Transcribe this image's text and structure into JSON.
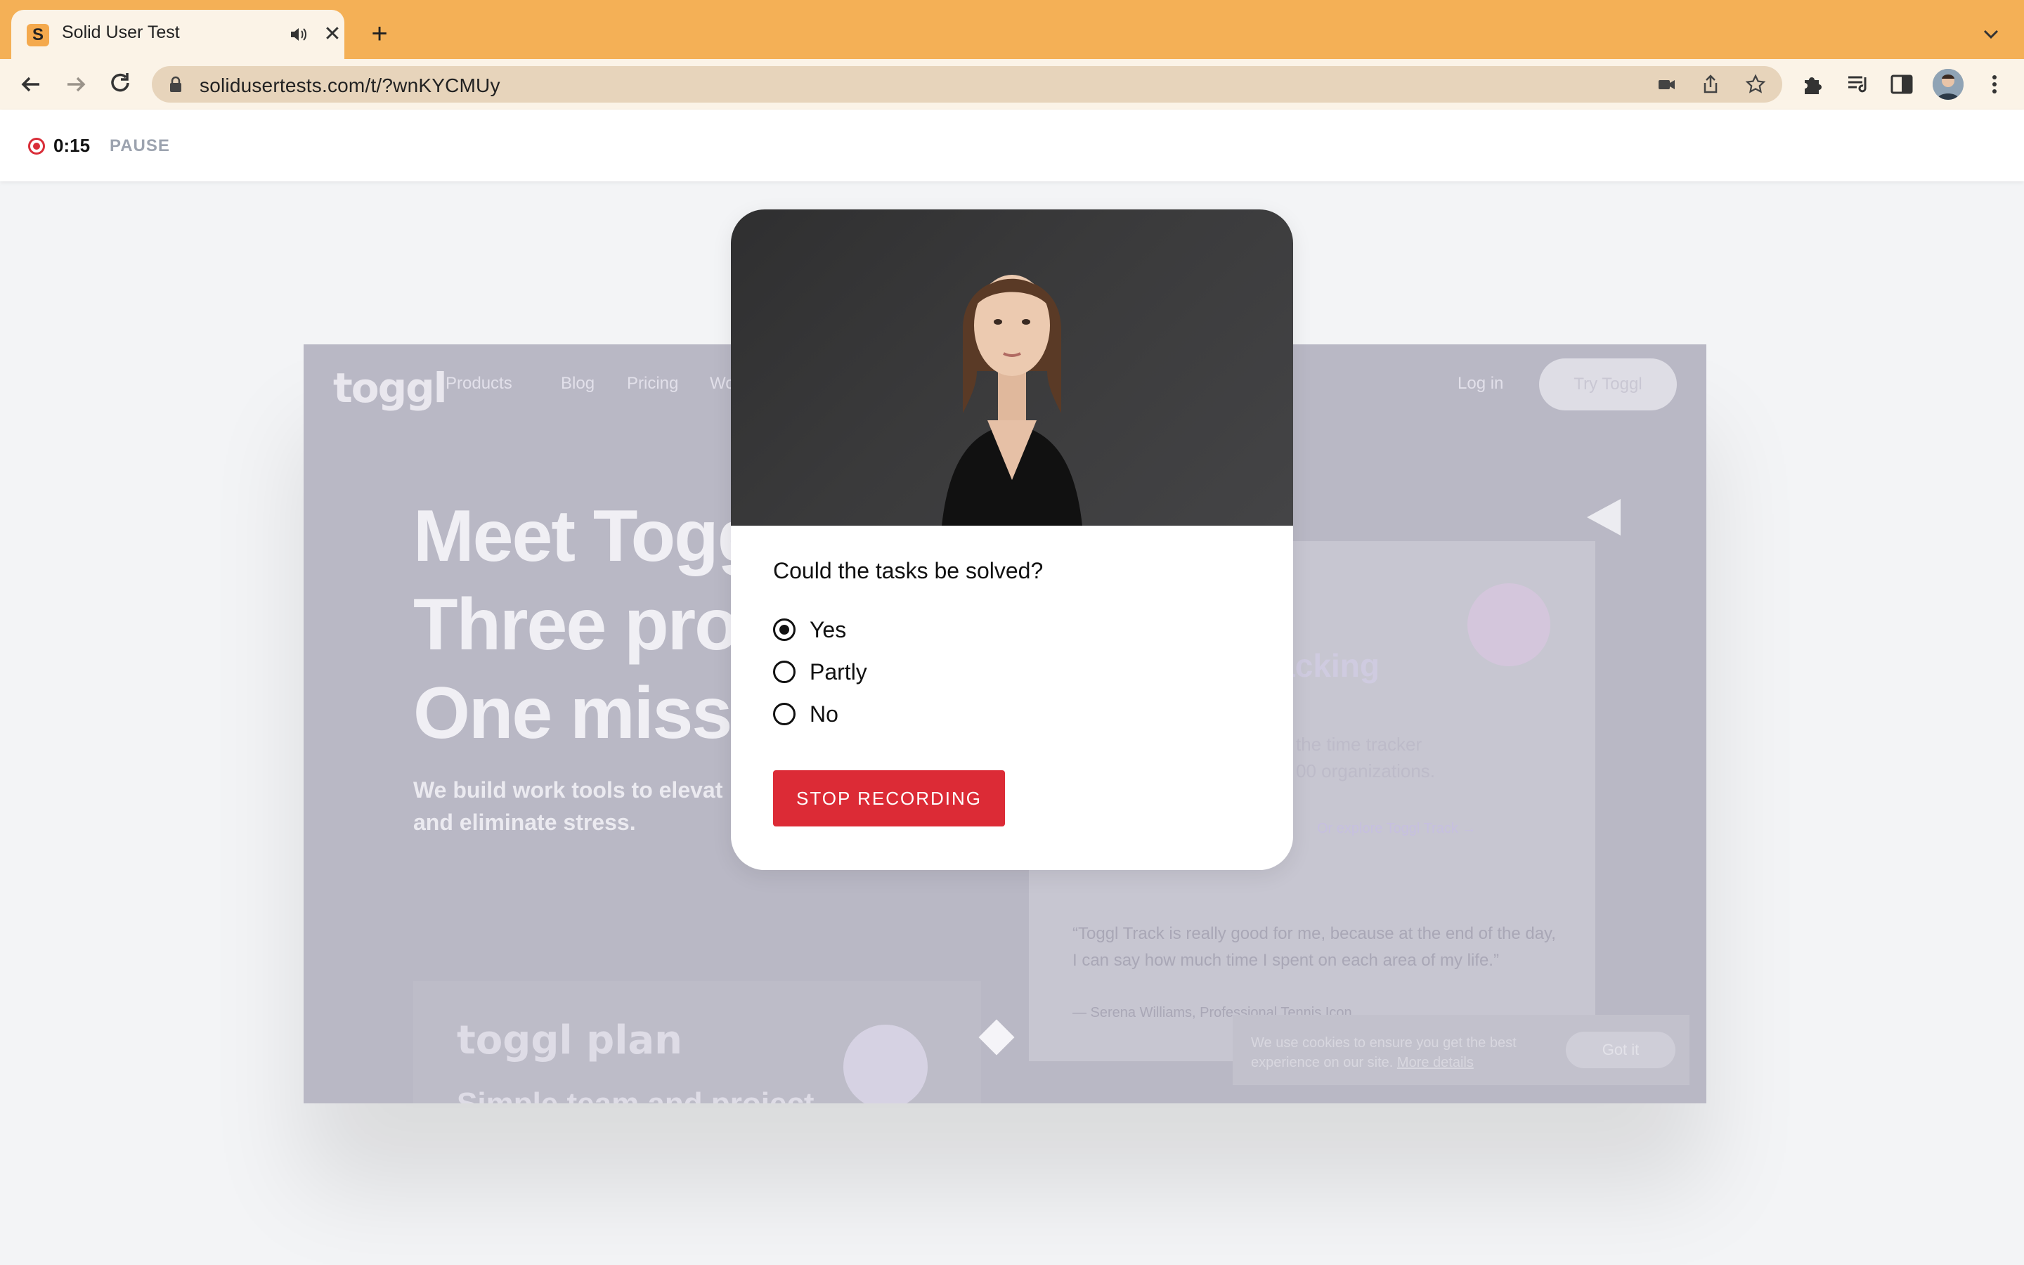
{
  "browser": {
    "tab": {
      "favicon_letter": "S",
      "title": "Solid User Test"
    },
    "url": "solidusertests.com/t/?wnKYCMUy"
  },
  "recording": {
    "time": "0:15",
    "pause_label": "PAUSE"
  },
  "background_site": {
    "logo": "toggl",
    "nav": [
      "Products",
      "Blog",
      "Pricing",
      "Wo"
    ],
    "login": "Log in",
    "try_button": "Try Toggl",
    "hero_lines": [
      "Meet Togg",
      "Three proc",
      "One missi"
    ],
    "sub_lines": [
      "We build work tools to elevat",
      "and eliminate stress."
    ],
    "card_heading": "tracking",
    "card_text_lines": [
      "the time tracker",
      "00 organizations."
    ],
    "card_link": "Or explore Toggl Track →",
    "quote": "“Toggl Track is really good for me, because at the end of the day, I can say how much time I spent on each area of my life.”",
    "quote_cite": "— Serena Williams, Professional Tennis Icon",
    "plan_logo": "toggl plan",
    "plan_heading": "Simple team and project",
    "cookie_text_line1": "We use cookies to ensure you get the best",
    "cookie_text_line2": "experience on our site.",
    "cookie_link": "More details",
    "cookie_button": "Got it"
  },
  "modal": {
    "question": "Could the tasks be solved?",
    "options": [
      {
        "label": "Yes",
        "selected": true
      },
      {
        "label": "Partly",
        "selected": false
      },
      {
        "label": "No",
        "selected": false
      }
    ],
    "stop_button": "STOP RECORDING"
  },
  "colors": {
    "accent": "#dc2b36",
    "tabstrip": "#f4b056",
    "toolbar": "#fbf3e7"
  }
}
